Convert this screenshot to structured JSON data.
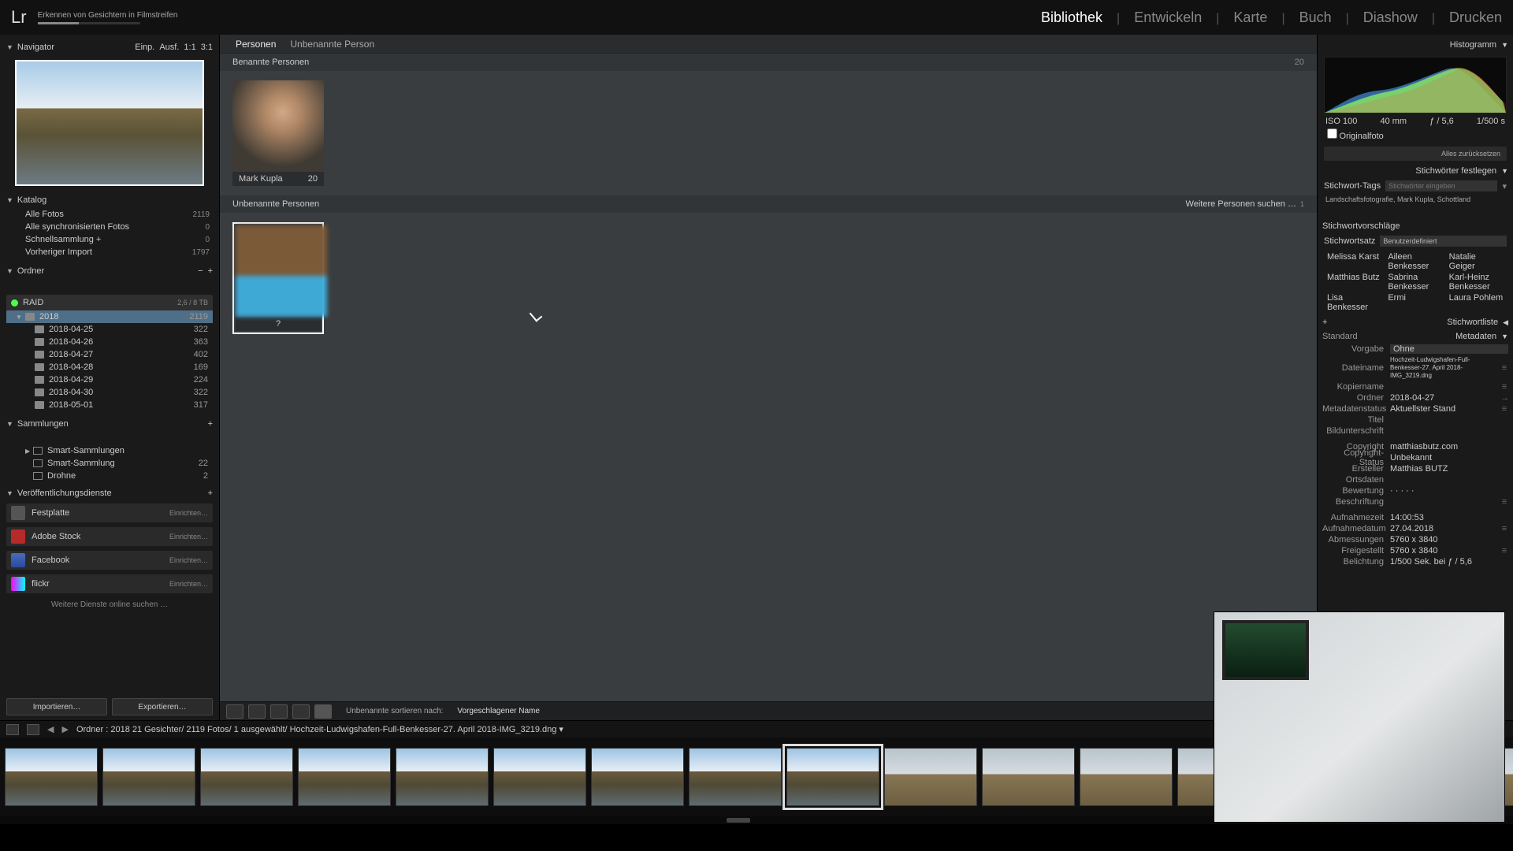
{
  "app": {
    "logo": "Lr",
    "task_title": "Erkennen von Gesichtern in Filmstreifen"
  },
  "modules": {
    "library": "Bibliothek",
    "develop": "Entwickeln",
    "map": "Karte",
    "book": "Buch",
    "slideshow": "Diashow",
    "print": "Drucken"
  },
  "nav": {
    "title": "Navigator",
    "zoom": {
      "a": "Einp.",
      "b": "Ausf.",
      "c": "1:1",
      "d": "3:1"
    }
  },
  "catalog": {
    "title": "Katalog",
    "items": [
      {
        "label": "Alle Fotos",
        "count": "2119"
      },
      {
        "label": "Alle synchronisierten Fotos",
        "count": "0"
      },
      {
        "label": "Schnellsammlung  +",
        "count": "0"
      },
      {
        "label": "Vorheriger Import",
        "count": "1797"
      }
    ]
  },
  "folders": {
    "title": "Ordner",
    "drive": {
      "name": "RAID",
      "usage": "2,6 / 8 TB"
    },
    "year": {
      "label": "2018",
      "count": "2119"
    },
    "children": [
      {
        "label": "2018-04-25",
        "count": "322"
      },
      {
        "label": "2018-04-26",
        "count": "363"
      },
      {
        "label": "2018-04-27",
        "count": "402"
      },
      {
        "label": "2018-04-28",
        "count": "169"
      },
      {
        "label": "2018-04-29",
        "count": "224"
      },
      {
        "label": "2018-04-30",
        "count": "322"
      },
      {
        "label": "2018-05-01",
        "count": "317"
      }
    ]
  },
  "collections": {
    "title": "Sammlungen",
    "items": [
      {
        "label": "Smart-Sammlungen",
        "count": ""
      },
      {
        "label": "Smart-Sammlung",
        "count": "22"
      },
      {
        "label": "Drohne",
        "count": "2"
      }
    ]
  },
  "publish": {
    "title": "Veröffentlichungsdienste",
    "hd": "Festplatte",
    "stock": "Adobe Stock",
    "fb": "Facebook",
    "flickr": "flickr",
    "setup": "Einrichten…",
    "more": "Weitere Dienste online suchen …"
  },
  "buttons": {
    "import": "Importieren…",
    "export": "Exportieren…"
  },
  "center": {
    "bc_people": "Personen",
    "bc_unnamed": "Unbenannte Person",
    "named_header": "Benannte Personen",
    "named_count": "20",
    "named_person": "Mark Kupla",
    "named_person_count": "20",
    "unnamed_header": "Unbenannte Personen",
    "unnamed_more": "Weitere Personen suchen …",
    "unnamed_label": "?",
    "tb_sort_label": "Unbenannte sortieren nach:",
    "tb_sort_val": "Vorgeschlagener Name"
  },
  "right": {
    "histo_title": "Histogramm",
    "iso": "ISO 100",
    "focal": "40 mm",
    "ap": "ƒ / 5,6",
    "sh": "1/500 s",
    "orig": "Originalfoto",
    "reset": "Alles zurücksetzen",
    "kw_title": "Stichwörter festlegen",
    "kw_tags_label": "Stichwort-Tags",
    "kw_placeholder": "Stichwörter eingeben",
    "kw_applied": "Landschaftsfotografie, Mark Kupla, Schottland",
    "sugg_title": "Stichwortvorschläge",
    "kw_set_label": "Stichwortsatz",
    "kw_set_val": "Benutzerdefiniert",
    "sugg": [
      "Melissa Karst",
      "Aileen Benkesser",
      "Natalie Geiger",
      "Matthias Butz",
      "Sabrina Benkesser",
      "Karl-Heinz Benkesser",
      "Lisa Benkesser",
      "Ermi",
      "Laura Pohlem"
    ],
    "kwl_title": "Stichwortliste",
    "meta_title": "Metadaten",
    "meta_preset_label": "Standard",
    "rows": {
      "vorgabe_l": "Vorgabe",
      "vorgabe_v": "Ohne",
      "file_l": "Dateiname",
      "file_v": "Hochzeit-Ludwigshafen-Full-Benkesser-27. April 2018-IMG_3219.dng",
      "copy_l": "Kopiername",
      "copy_v": "",
      "folder_l": "Ordner",
      "folder_v": "2018-04-27",
      "metastat_l": "Metadatenstatus",
      "metastat_v": "Aktuellster Stand",
      "title_l": "Titel",
      "title_v": "",
      "caption_l": "Bildunterschrift",
      "caption_v": "",
      "copyright_l": "Copyright",
      "copyright_v": "matthiasbutz.com",
      "cstatus_l": "Copyright-Status",
      "cstatus_v": "Unbekannt",
      "creator_l": "Ersteller",
      "creator_v": "Matthias BUTZ",
      "loc_l": "Ortsdaten",
      "loc_v": "",
      "rating_l": "Bewertung",
      "rating_v": "·  ·  ·  ·  ·",
      "label_l": "Beschriftung",
      "label_v": "",
      "time_l": "Aufnahmezeit",
      "time_v": "14:00:53",
      "date_l": "Aufnahmedatum",
      "date_v": "27.04.2018",
      "dim_l": "Abmessungen",
      "dim_v": "5760 x 3840",
      "crop_l": "Freigestellt",
      "crop_v": "5760 x 3840",
      "exp_l": "Belichtung",
      "exp_v": "1/500 Sek. bei ƒ / 5,6"
    }
  },
  "pathbar": {
    "text": "Ordner : 2018   21 Gesichter/ 2119 Fotos/ 1 ausgewählt/ Hochzeit-Ludwigshafen-Full-Benkesser-27. April 2018-IMG_3219.dng ▾"
  }
}
